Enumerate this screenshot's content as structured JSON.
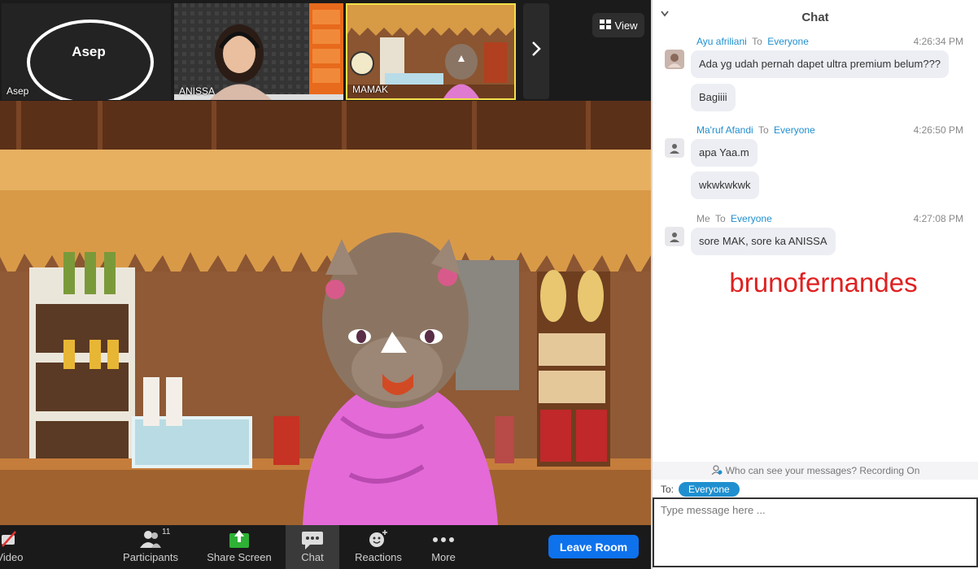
{
  "thumbnails": [
    {
      "name": "Asep",
      "display_initials": "Asep"
    },
    {
      "name": "ANISSA"
    },
    {
      "name": "MAMAK"
    }
  ],
  "view_button": {
    "label": "View",
    "icon": "grid-view-icon"
  },
  "toolbar": {
    "video_label": "Video",
    "participants_label": "Participants",
    "participants_count": "11",
    "share_label": "Share Screen",
    "chat_label": "Chat",
    "reactions_label": "Reactions",
    "more_label": "More",
    "leave_label": "Leave Room",
    "colors": {
      "share_icon": "#2eb135",
      "leave": "#0e72ed"
    }
  },
  "chat": {
    "title": "Chat",
    "messages": [
      {
        "sender": "Ayu afriliani",
        "to_word": "To",
        "recipient": "Everyone",
        "time": "4:26:34 PM",
        "texts": [
          "Ada yg udah pernah dapet ultra premium belum???",
          "Bagiiii"
        ]
      },
      {
        "sender": "Ma'ruf Afandi",
        "to_word": "To",
        "recipient": "Everyone",
        "time": "4:26:50 PM",
        "texts": [
          "apa Yaa.m",
          "wkwkwkwk"
        ]
      },
      {
        "sender": "Me",
        "to_word": "To",
        "recipient": "Everyone",
        "time": "4:27:08 PM",
        "texts": [
          "sore MAK, sore ka ANISSA"
        ]
      }
    ],
    "overlay_text": "brunofernandes",
    "privacy_text": "Who can see your messages? Recording On",
    "to_label": "To:",
    "to_value": "Everyone",
    "input_placeholder": "Type message here ...",
    "input_value": ""
  }
}
